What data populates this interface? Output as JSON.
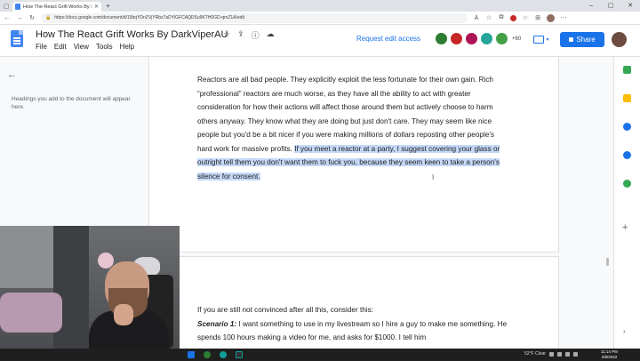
{
  "browser": {
    "tab_title": "How The React Grift Works By Da",
    "url": "https://docs.google.com/document/d/15bqYDnZVjYRbz7aDYlGFCAQDSu9KTH0GD-qmZ1A/edit",
    "colors": {
      "profile": "#c62828",
      "extension": "#1a73e8"
    }
  },
  "docs": {
    "title": "How The React Grift Works By DarkViperAU",
    "menus": [
      "File",
      "Edit",
      "View",
      "Tools",
      "Help"
    ],
    "request_edit": "Request edit access",
    "more_viewers": "+60",
    "share_label": "Share",
    "colors": {
      "accent": "#1a73e8",
      "selection": "#c5d9f7"
    }
  },
  "outline": {
    "hint": "Headings you add to the document will appear here."
  },
  "page1": {
    "paragraph_plain": "Reactors are all bad people. They explicitly exploit the less fortunate for their own gain. Rich “professional” reactors are much worse, as they have all the ability to act with greater consideration for how their actions will affect those around them but actively choose to harm others anyway. They know what they are doing but just don't care. They may seem like nice people but you'd be a bit nicer if you were making millions of dollars reposting other people's hard work for massive profits. ",
    "paragraph_selected": "If you meet a reactor at a party, I suggest covering your glass or outright tell them you don't want them to fuck you, because they seem keen to take a person's silence for consent."
  },
  "page2": {
    "intro": "If you are still not convinced after all this, consider this:",
    "scenario_label": "Scenario 1:",
    "scenario_text": " I want something to use in my livestream so I hire a guy to make me something. He spends 100 hours making a video for me, and asks for $1000. I tell him"
  },
  "taskbar": {
    "weather": "52°F Clear",
    "time": "11:14 PM",
    "date": "2/8/2022"
  }
}
